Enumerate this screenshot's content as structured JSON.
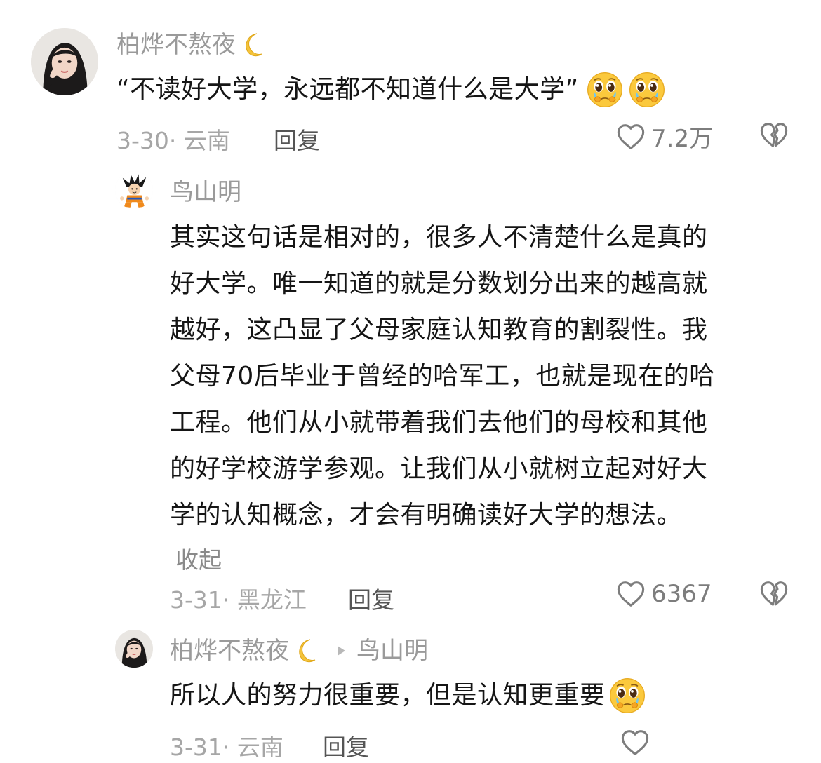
{
  "comments": [
    {
      "username": "柏烨不熬夜",
      "username_emoji": "crescent-moon-emoji",
      "text": "“不读好大学，永远都不知道什么是大学”",
      "text_emojis": [
        "pleading-face-emoji",
        "pleading-face-emoji"
      ],
      "date_location": "3-30· 云南",
      "reply_label": "回复",
      "like_count": "7.2万"
    },
    {
      "username": "鸟山明",
      "text_lines": [
        "其实这句话是相对的，很多人不清楚什么是真的",
        "好大学。唯一知道的就是分数划分出来的越高就",
        "越好，这凸显了父母家庭认知教育的割裂性。我",
        "父母70后毕业于曾经的哈军工，也就是现在的哈",
        "工程。他们从小就带着我们去他们的母校和其他",
        "的好学校游学参观。让我们从小就树立起对好大",
        "学的认知概念，才会有明确读好大学的想法。"
      ],
      "collapse_label": "收起",
      "date_location": "3-31· 黑龙江",
      "reply_label": "回复",
      "like_count": "6367"
    },
    {
      "username": "柏烨不熬夜",
      "username_emoji": "crescent-moon-emoji",
      "reply_to": "鸟山明",
      "text": "所以人的努力很重要，但是认知更重要",
      "text_emojis": [
        "pleading-face-emoji"
      ],
      "date_location": "3-31· 云南",
      "reply_label": "回复"
    }
  ],
  "colors": {
    "username": "#9a9a9a",
    "text": "#151515",
    "meta": "#a6a6a6",
    "reply": "#555555",
    "icon": "#7d7d7d"
  }
}
